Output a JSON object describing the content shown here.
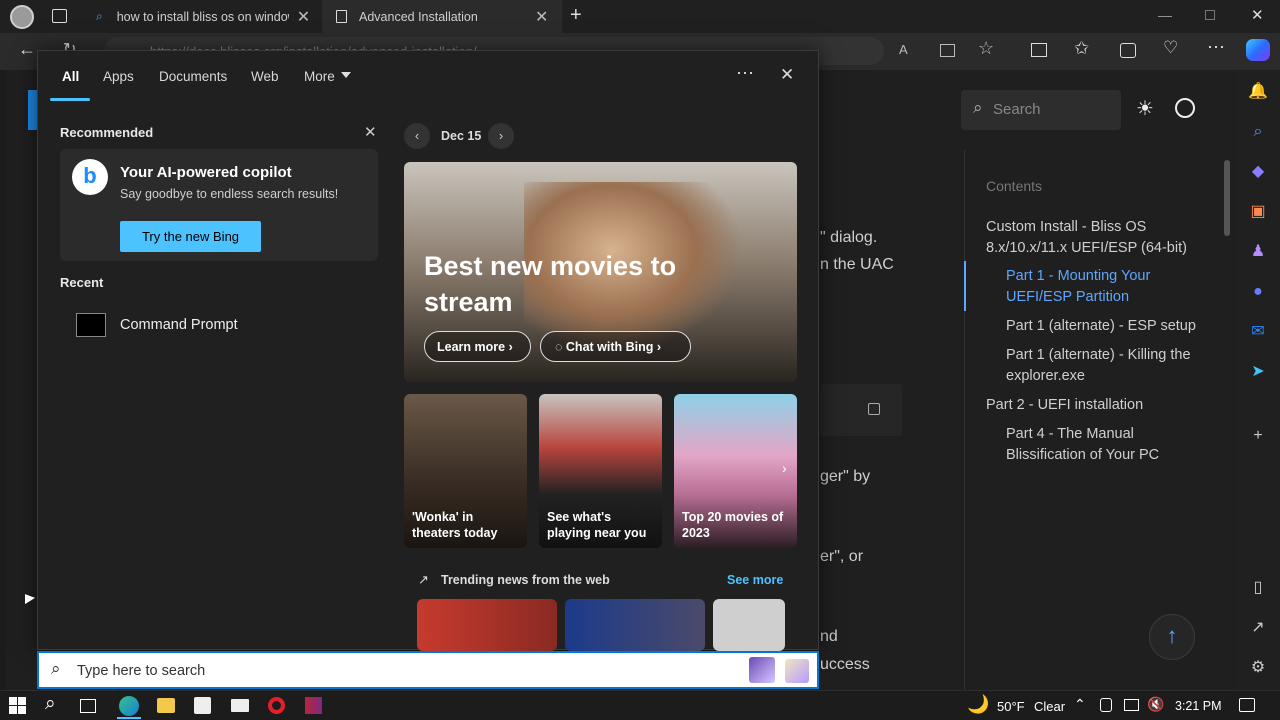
{
  "browser": {
    "tabs": [
      {
        "label": "how to install bliss os on window"
      },
      {
        "label": "Advanced Installation"
      }
    ],
    "address": "https://docs.blissos.org/installation/advanced-installation/"
  },
  "docs": {
    "search_placeholder": "Search",
    "contents_heading": "Contents",
    "toc": [
      {
        "label": "Custom Install - Bliss OS 8.x/10.x/11.x UEFI/ESP (64-bit)"
      },
      {
        "label": "Part 1 - Mounting Your UEFI/ESP Partition"
      },
      {
        "label": "Part 1 (alternate) - ESP setup"
      },
      {
        "label": "Part 1 (alternate) - Killing the explorer.exe"
      },
      {
        "label": "Part 2 - UEFI installation"
      },
      {
        "label": "Part 4 - The Manual Blissification of Your PC"
      }
    ],
    "snippets": [
      "\" dialog.",
      "n the UAC",
      "ger\" by",
      "er\", or",
      "nd",
      "uccess"
    ]
  },
  "search_panel": {
    "tabs": [
      "All",
      "Apps",
      "Documents",
      "Web",
      "More"
    ],
    "recommended_heading": "Recommended",
    "copilot": {
      "title": "Your AI-powered copilot",
      "subtitle": "Say goodbye to endless search results!",
      "button": "Try the new Bing"
    },
    "recent_heading": "Recent",
    "recent_items": [
      {
        "label": "Command Prompt"
      }
    ],
    "date": "Dec 15",
    "hero": {
      "title": "Best new movies to stream",
      "learn_more": "Learn more",
      "chat": "Chat with Bing"
    },
    "tiles": [
      {
        "caption": "'Wonka' in theaters today"
      },
      {
        "caption": "See what's playing near you"
      },
      {
        "caption": "Top 20 movies of 2023"
      }
    ],
    "trending_heading": "Trending news from the web",
    "see_more": "See more",
    "search_placeholder": "Type here to search"
  },
  "taskbar": {
    "temperature": "50°F",
    "weather": "Clear",
    "time": "3:21 PM"
  },
  "colors": {
    "accent": "#0078d4",
    "link_blue": "#5ea6ff",
    "panel_bg": "#202020",
    "button_blue": "#4cc2ff"
  }
}
